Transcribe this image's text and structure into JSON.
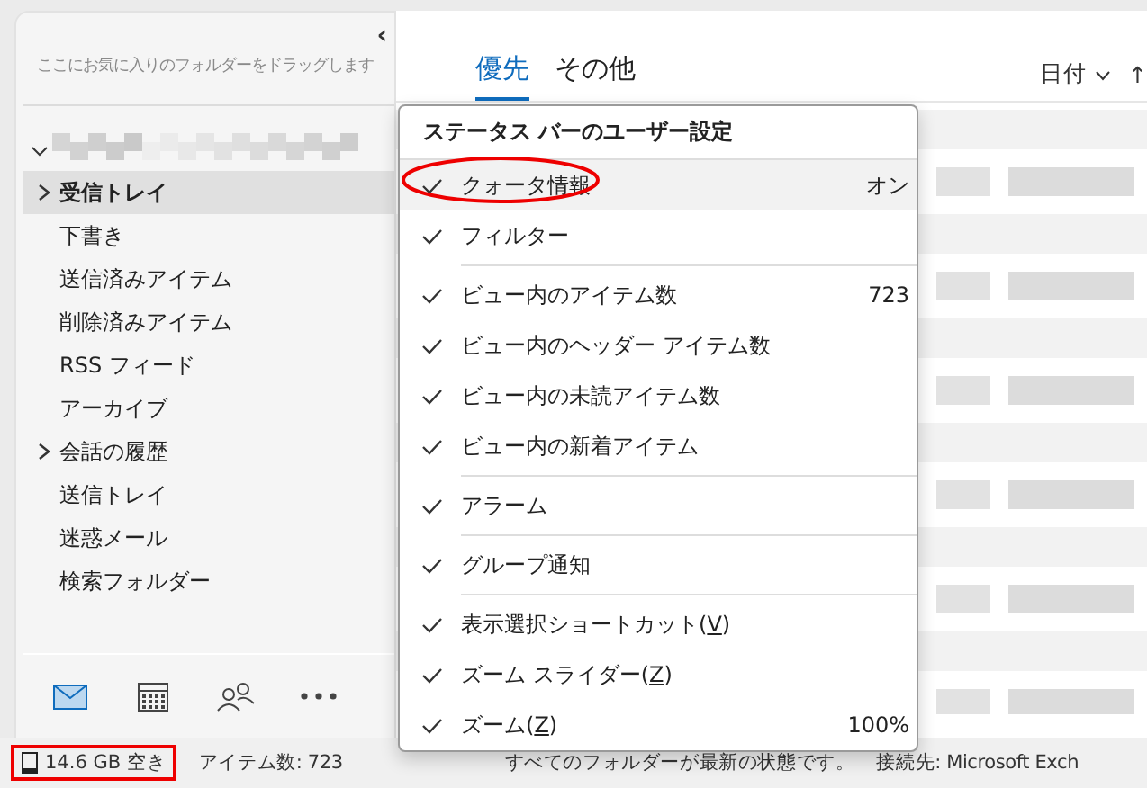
{
  "sidebar": {
    "favorites_hint": "ここにお気に入りのフォルダーをドラッグします",
    "collapse_glyph": "‹",
    "account": {
      "expanded": true
    },
    "folders": [
      {
        "label": "受信トレイ",
        "kind": "expandable",
        "selected": true
      },
      {
        "label": "下書き",
        "kind": "leaf",
        "selected": false
      },
      {
        "label": "送信済みアイテム",
        "kind": "leaf",
        "selected": false
      },
      {
        "label": "削除済みアイテム",
        "kind": "leaf",
        "selected": false
      },
      {
        "label": "RSS フィード",
        "kind": "leaf",
        "selected": false
      },
      {
        "label": "アーカイブ",
        "kind": "leaf",
        "selected": false
      },
      {
        "label": "会話の履歴",
        "kind": "expandable",
        "selected": false
      },
      {
        "label": "送信トレイ",
        "kind": "leaf",
        "selected": false
      },
      {
        "label": "迷惑メール",
        "kind": "leaf",
        "selected": false
      },
      {
        "label": "検索フォルダー",
        "kind": "leaf",
        "selected": false
      }
    ],
    "nav": [
      {
        "kind": "mail",
        "selected": true
      },
      {
        "kind": "calendar",
        "selected": false
      },
      {
        "kind": "people",
        "selected": false
      },
      {
        "kind": "more",
        "selected": false
      }
    ]
  },
  "list": {
    "tabs": [
      {
        "label": "優先",
        "selected": true
      },
      {
        "label": "その他",
        "selected": false
      }
    ],
    "sort": "日付",
    "sort_direction": "↑"
  },
  "menu": {
    "title": "ステータス バーのユーザー設定",
    "groups": [
      [
        {
          "label": "クォータ情報",
          "checked": true,
          "selected": true,
          "value": "オン"
        },
        {
          "label": "フィルター",
          "checked": true,
          "selected": false
        }
      ],
      [
        {
          "label": "ビュー内のアイテム数",
          "checked": true,
          "selected": false,
          "value": "723"
        },
        {
          "label": "ビュー内のヘッダー アイテム数",
          "checked": true,
          "selected": false
        },
        {
          "label": "ビュー内の未読アイテム数",
          "checked": true,
          "selected": false
        },
        {
          "label": "ビュー内の新着アイテム",
          "checked": true,
          "selected": false
        }
      ],
      [
        {
          "label": "アラーム",
          "checked": true,
          "selected": false
        }
      ],
      [
        {
          "label": "グループ通知",
          "checked": true,
          "selected": false
        }
      ],
      [
        {
          "label": "表示選択ショートカット(",
          "accel": "V",
          "label_after": ")",
          "checked": true,
          "selected": false
        },
        {
          "label": "ズーム スライダー(",
          "accel": "Z",
          "label_after": ")",
          "checked": true,
          "selected": false
        },
        {
          "label": "ズーム(",
          "accel": "Z",
          "label_after": ")",
          "checked": true,
          "selected": false,
          "value": "100%"
        }
      ]
    ]
  },
  "status_bar": {
    "quota": "14.6 GB 空き",
    "item_count": "アイテム数: 723",
    "sync": "すべてのフォルダーが最新の状態です。",
    "connection": "接続先: Microsoft Exch"
  }
}
